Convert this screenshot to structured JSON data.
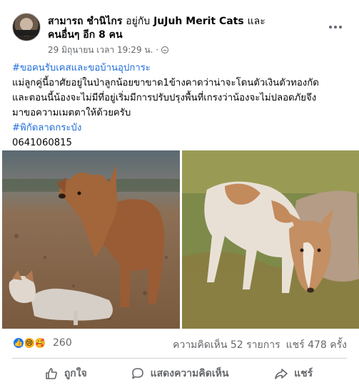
{
  "post": {
    "author": "สามารถ ชำนิไกร",
    "with_text": "อยู่กับ",
    "tagged_page": "JuJuh Merit Cats",
    "and_text": "และ",
    "others_text": "คนอื่นๆ อีก 8 คน",
    "timestamp": "29 มิถุนายน เวลา 19:29 น.",
    "separator": "·",
    "privacy_icon": "globe-icon",
    "more_icon": "more-options-icon",
    "hashtag1": "#ขอคนรับเคสและขอบ้านอุปการะ",
    "body_line1": "แม่ลูกคู่นี้อาศัยอยู่ในป่าลูกน้อยขาขาด1ข้างคาดว่าน่าจะโดนตัวเงินตัวทองกัด",
    "body_line2": "และตอนนี้น้องจะไม่มีที่อยู่เริ่มมีการปรับปรุงพื้นที่เกรงว่าน้องจะไม่ปลอดภัยจึง",
    "body_line3": "มาขอความเมตตาให้ด้วยครับ",
    "hashtag2": "#พิกัดลาดกระบัง",
    "phone": "0641060815"
  },
  "engagement": {
    "reaction_icons": [
      "like-icon",
      "sad-icon",
      "care-icon"
    ],
    "reaction_count": "260",
    "comments": "ความคิดเห็น 52 รายการ",
    "shares": "แชร์ 478 ครั้ง"
  },
  "actions": {
    "like": "ถูกใจ",
    "comment": "แสดงความคิดเห็น",
    "share": "แชร์"
  },
  "colors": {
    "link": "#216fdb",
    "secondary_text": "#65676b",
    "like_blue": "#1877f2"
  }
}
